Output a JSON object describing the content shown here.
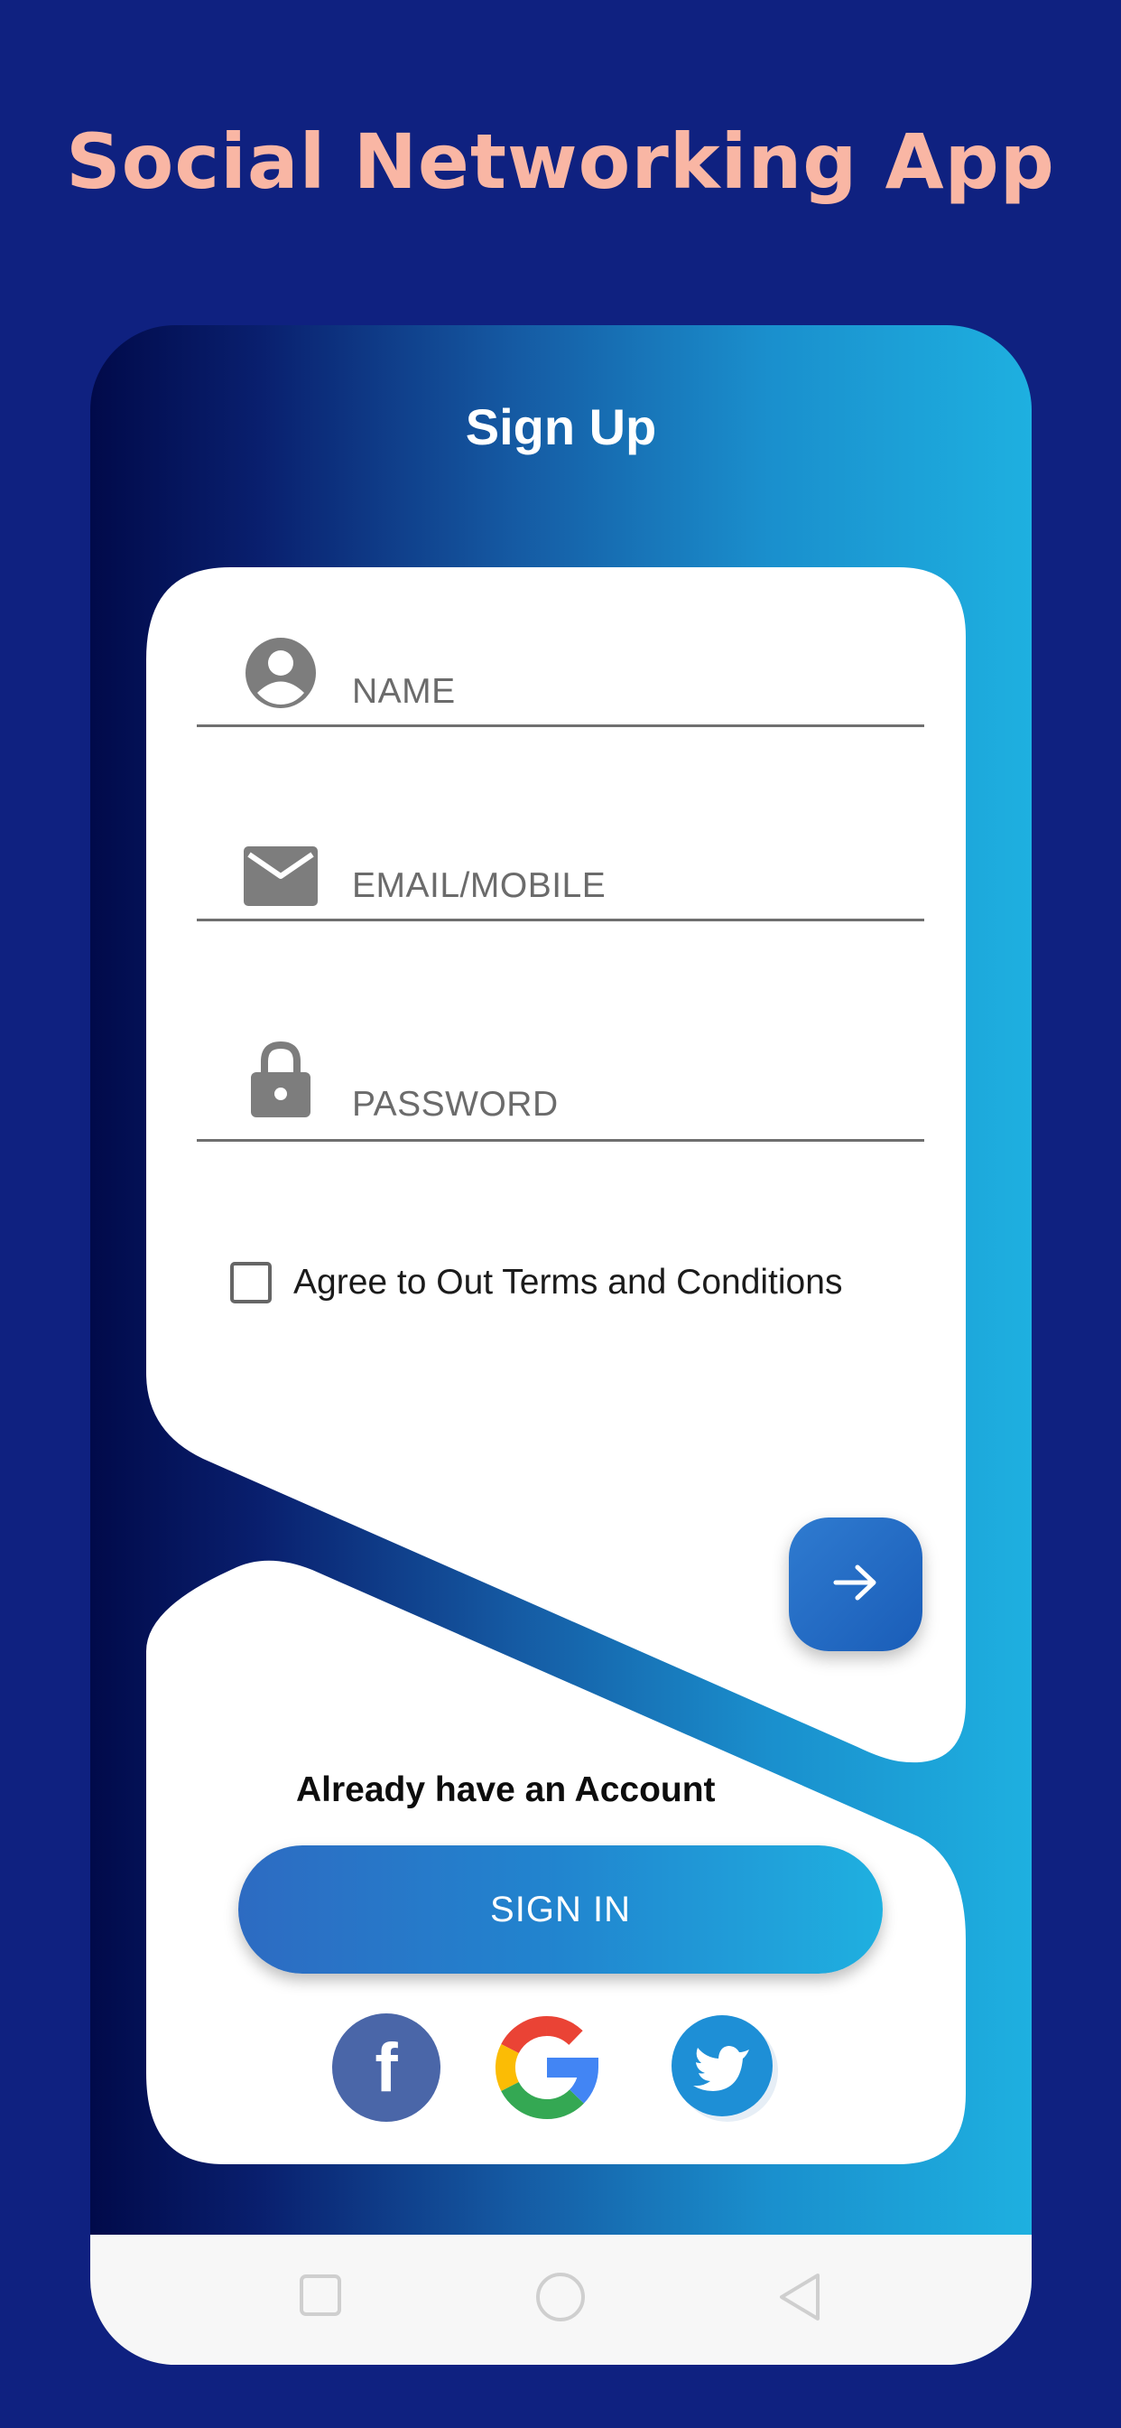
{
  "header": {
    "app_title": "Social Networking App"
  },
  "screen": {
    "title": "Sign Up"
  },
  "form": {
    "name_placeholder": "NAME",
    "email_placeholder": "EMAIL/MOBILE",
    "password_placeholder": "PASSWORD",
    "terms_label": "Agree to Out Terms and Conditions",
    "terms_checked": false
  },
  "signin": {
    "prompt": "Already have an Account",
    "button_label": "SIGN IN"
  },
  "social": {
    "facebook_letter": "f",
    "google_letter": "G"
  },
  "icons": {
    "name": "account-circle-icon",
    "email": "mail-icon",
    "password": "lock-icon",
    "next": "arrow-right-icon",
    "nav_recent": "square-icon",
    "nav_home": "circle-icon",
    "nav_back": "triangle-back-icon"
  },
  "colors": {
    "page_background": "#0f2180",
    "title": "#f9b6a4",
    "facebook": "#4a66a8",
    "twitter": "#1e8fd6",
    "accent": "#1eb0e0"
  }
}
